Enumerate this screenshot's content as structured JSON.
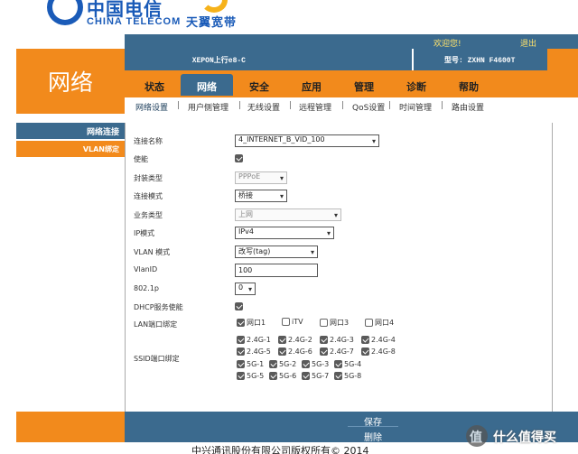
{
  "brand": {
    "china_telecom_cn": "中国电信",
    "china_telecom_en": "CHINA TELECOM",
    "tianyi": "天翼宽带"
  },
  "topbar": {
    "welcome": "欢迎您!",
    "logout": "退出",
    "device_info": "XEPON上行e8-C",
    "model": "型号: ZXHN F4600T"
  },
  "section_title": "网络",
  "tabs": [
    {
      "label": "状态"
    },
    {
      "label": "网络"
    },
    {
      "label": "安全"
    },
    {
      "label": "应用"
    },
    {
      "label": "管理"
    },
    {
      "label": "诊断"
    },
    {
      "label": "帮助"
    }
  ],
  "subnav": [
    {
      "label": "网络设置"
    },
    {
      "label": "用户侧管理"
    },
    {
      "label": "无线设置"
    },
    {
      "label": "远程管理"
    },
    {
      "label": "QoS设置"
    },
    {
      "label": "时间管理"
    },
    {
      "label": "路由设置"
    }
  ],
  "sidebar": {
    "items": [
      {
        "label": "网络连接"
      },
      {
        "label": "VLAN绑定"
      }
    ]
  },
  "form": {
    "conn_name": {
      "label": "连接名称",
      "value": "4_INTERNET_B_VID_100"
    },
    "enable": {
      "label": "使能",
      "checked": true
    },
    "encap": {
      "label": "封装类型",
      "value": "PPPoE"
    },
    "conn_mode": {
      "label": "连接模式",
      "value": "桥接"
    },
    "service": {
      "label": "业务类型",
      "value": "上网"
    },
    "ip_mode": {
      "label": "IP模式",
      "value": "IPv4"
    },
    "vlan_mode": {
      "label": "VLAN 模式",
      "value": "改写(tag)"
    },
    "vlan_id": {
      "label": "VlanID",
      "value": "100"
    },
    "dot1p": {
      "label": "802.1p",
      "value": "0"
    },
    "dhcp": {
      "label": "DHCP服务使能",
      "checked": true
    },
    "lan_bind": {
      "label": "LAN端口绑定",
      "ports": [
        {
          "label": "网口1",
          "checked": true
        },
        {
          "label": "iTV",
          "checked": false
        },
        {
          "label": "网口3",
          "checked": false
        },
        {
          "label": "网口4",
          "checked": false
        }
      ]
    },
    "ssid_bind": {
      "label": "SSID端口绑定",
      "ports": [
        {
          "label": "2.4G-1",
          "checked": true
        },
        {
          "label": "2.4G-2",
          "checked": true
        },
        {
          "label": "2.4G-3",
          "checked": true
        },
        {
          "label": "2.4G-4",
          "checked": true
        },
        {
          "label": "2.4G-5",
          "checked": true
        },
        {
          "label": "2.4G-6",
          "checked": true
        },
        {
          "label": "2.4G-7",
          "checked": true
        },
        {
          "label": "2.4G-8",
          "checked": true
        },
        {
          "label": "5G-1",
          "checked": true
        },
        {
          "label": "5G-2",
          "checked": true
        },
        {
          "label": "5G-3",
          "checked": true
        },
        {
          "label": "5G-4",
          "checked": true
        },
        {
          "label": "5G-5",
          "checked": true
        },
        {
          "label": "5G-6",
          "checked": true
        },
        {
          "label": "5G-7",
          "checked": true
        },
        {
          "label": "5G-8",
          "checked": true
        }
      ]
    }
  },
  "buttons": {
    "save": "保存",
    "delete": "删除"
  },
  "footer": {
    "copyright": "中兴通讯股份有限公司版权所有© 2014"
  },
  "watermark": {
    "badge": "值",
    "text": "什么值得买"
  },
  "colors": {
    "orange": "#f28a1c",
    "blue": "#3b6a8e",
    "brand_blue": "#1a5bb8",
    "yellow": "#f6b21a"
  }
}
